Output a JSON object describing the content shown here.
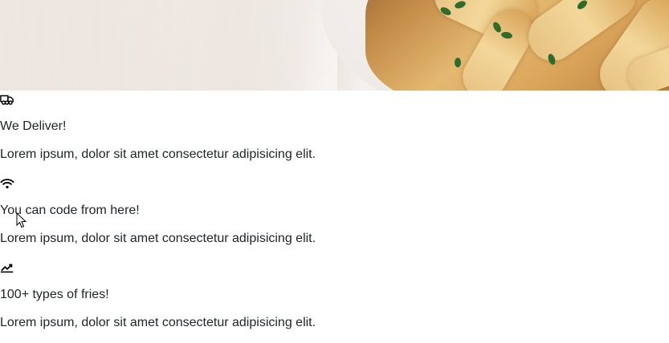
{
  "hero": {
    "icon": "fries-photo"
  },
  "features": [
    {
      "icon": "truck-icon",
      "title": "We Deliver!",
      "description": "Lorem ipsum, dolor sit amet consectetur adipisicing elit."
    },
    {
      "icon": "wifi-icon",
      "title": "You can code from here!",
      "description": "Lorem ipsum, dolor sit amet consectetur adipisicing elit."
    },
    {
      "icon": "chart-line-icon",
      "title": "100+ types of fries!",
      "description": "Lorem ipsum, dolor sit amet consectetur adipisicing elit."
    }
  ],
  "colors": {
    "text": "#212529",
    "background": "#ffffff"
  }
}
